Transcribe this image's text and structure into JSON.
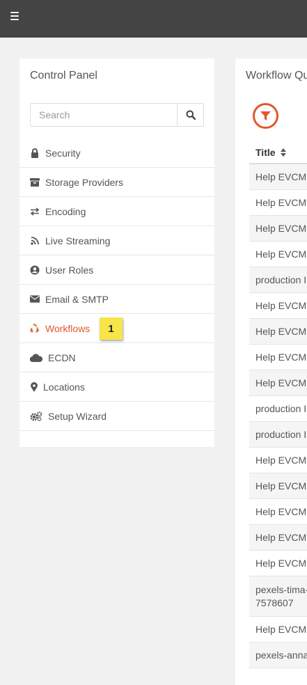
{
  "topbar": {
    "menu_icon": "hamburger-icon"
  },
  "sidebar": {
    "title": "Control Panel",
    "search": {
      "placeholder": "Search",
      "value": ""
    },
    "items": [
      {
        "label": "Security",
        "icon": "lock-icon"
      },
      {
        "label": "Storage Providers",
        "icon": "archive-icon"
      },
      {
        "label": "Encoding",
        "icon": "exchange-icon"
      },
      {
        "label": "Live Streaming",
        "icon": "rss-icon"
      },
      {
        "label": "User Roles",
        "icon": "user-circle-icon"
      },
      {
        "label": "Email & SMTP",
        "icon": "envelope-icon"
      },
      {
        "label": "Workflows",
        "icon": "recycle-icon",
        "active": true,
        "badge": "1"
      },
      {
        "label": "ECDN",
        "icon": "cloud-icon"
      },
      {
        "label": "Locations",
        "icon": "map-marker-icon"
      },
      {
        "label": "Setup Wizard",
        "icon": "cogs-icon"
      }
    ]
  },
  "main": {
    "title": "Workflow Qu",
    "table": {
      "header": "Title",
      "rows": [
        "Help EVCM",
        "Help EVCM",
        "Help EVCM",
        "Help EVCM",
        "production I",
        "Help EVCM",
        "Help EVCM",
        "Help EVCM",
        "Help EVCM",
        "production I",
        "production I",
        "Help EVCM",
        "Help EVCM",
        "Help EVCM",
        "Help EVCM",
        "Help EVCM",
        "pexels-tima-\n7578607",
        "Help EVCM",
        "pexels-anna"
      ]
    }
  },
  "colors": {
    "accent": "#e2572a",
    "topbar": "#444444",
    "badge": "#f7e54a"
  }
}
